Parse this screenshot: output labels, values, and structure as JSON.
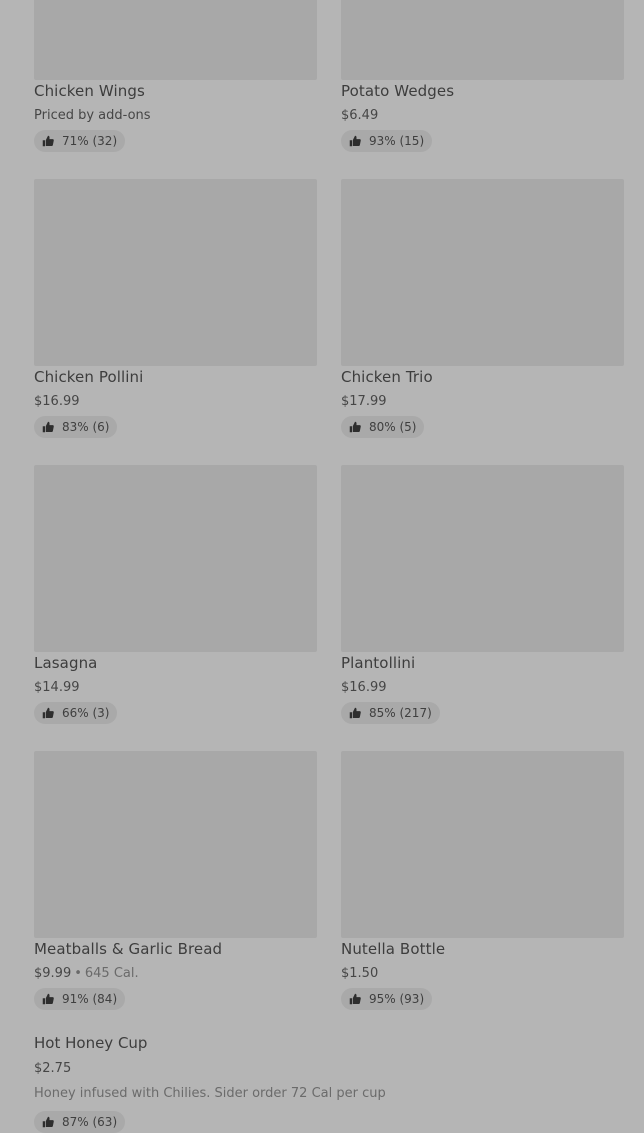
{
  "menu_items": [
    {
      "name": "Chicken Wings",
      "price": "Priced by add-ons",
      "rating": "71% (32)"
    },
    {
      "name": "Potato Wedges",
      "price": "$6.49",
      "rating": "93% (15)"
    },
    {
      "name": "Chicken Pollini",
      "price": "$16.99",
      "rating": "83% (6)"
    },
    {
      "name": "Chicken Trio",
      "price": "$17.99",
      "rating": "80% (5)"
    },
    {
      "name": "Lasagna",
      "price": "$14.99",
      "rating": "66% (3)"
    },
    {
      "name": "Plantollini",
      "price": "$16.99",
      "rating": "85% (217)"
    },
    {
      "name": "Meatballs  & Garlic Bread",
      "price": "$9.99",
      "separator": "•",
      "calories": "645 Cal.",
      "rating": "91% (84)"
    },
    {
      "name": "Nutella Bottle",
      "price": "$1.50",
      "rating": "95% (93)"
    }
  ],
  "featured_item": {
    "name": "Hot Honey Cup",
    "price": "$2.75",
    "description": "Honey infused with Chilies. Sider order 72 Cal per cup",
    "rating": "87% (63)"
  },
  "icons": {
    "rating": "thumbs-up-icon"
  },
  "colors": {
    "background": "#b5b5b5",
    "image_placeholder": "#a8a8a8",
    "rating_pill": "#a9a9a9",
    "text": "#3d3d3d",
    "muted_text": "#6b6b6b"
  }
}
